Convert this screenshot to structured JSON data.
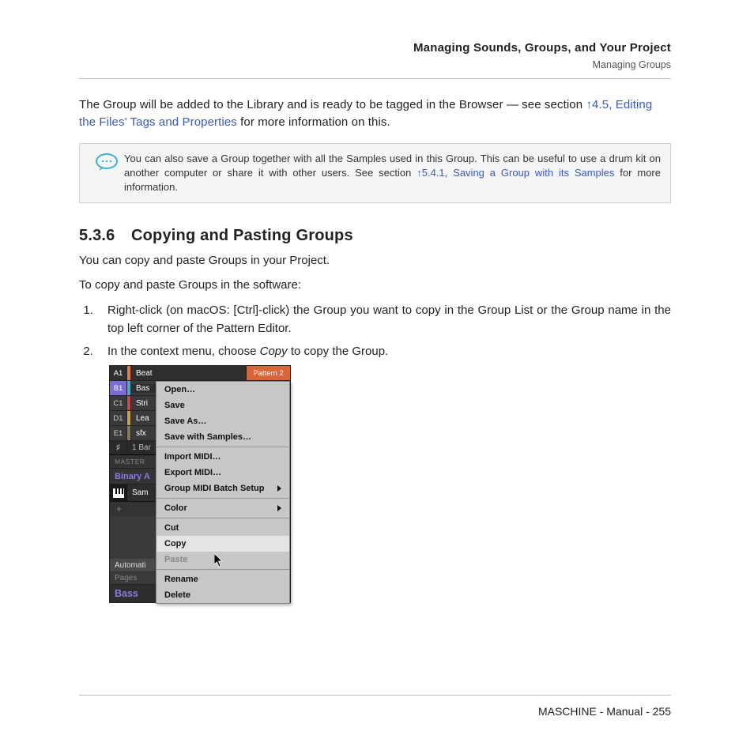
{
  "header": {
    "title": "Managing Sounds, Groups, and Your Project",
    "sub": "Managing Groups"
  },
  "intro": {
    "pre": "The Group will be added to the Library and is ready to be tagged in the Browser — see section ",
    "link": "↑4.5, Editing the Files' Tags and Properties",
    "post": " for more information on this."
  },
  "callout": {
    "pre": "You can also save a Group together with all the Samples used in this Group. This can be useful to use a drum kit on another computer or share it with other users. See section ",
    "link": "↑5.4.1, Saving a Group with its Samples",
    "post": " for more information."
  },
  "section": {
    "num": "5.3.6",
    "title": "Copying and Pasting Groups"
  },
  "p1": "You can copy and paste Groups in your Project.",
  "p2": "To copy and paste Groups in the software:",
  "steps": [
    "Right-click (on macOS: [Ctrl]-click) the Group you want to copy in the Group List or the Group name in the top left corner of the Pattern Editor.",
    {
      "pre": "In the context menu, choose ",
      "em": "Copy",
      "post": " to copy the Group."
    }
  ],
  "shot": {
    "rows": [
      {
        "id": "A1",
        "name": "Beat",
        "cls": "row-a",
        "pattern": "Pattern 2"
      },
      {
        "id": "B1",
        "name": "Bas",
        "cls": "row-b"
      },
      {
        "id": "C1",
        "name": "Stri",
        "cls": "row-c"
      },
      {
        "id": "D1",
        "name": "Lea",
        "cls": "row-d"
      },
      {
        "id": "E1",
        "name": "sfx",
        "cls": "row-e"
      }
    ],
    "bar": "1 Bar",
    "master": "MASTER",
    "binary": "Binary A",
    "sam": "Sam",
    "plus": "+",
    "auto": "Automati",
    "pages": "Pages",
    "bass": "Bass"
  },
  "ctx": {
    "items": [
      {
        "label": "Open…"
      },
      {
        "label": "Save"
      },
      {
        "label": "Save As…"
      },
      {
        "label": "Save with Samples…"
      },
      {
        "sep": true
      },
      {
        "label": "Import MIDI…"
      },
      {
        "label": "Export MIDI…"
      },
      {
        "label": "Group MIDI Batch Setup",
        "arrow": true
      },
      {
        "sep": true
      },
      {
        "label": "Color",
        "arrow": true
      },
      {
        "sep": true
      },
      {
        "label": "Cut"
      },
      {
        "label": "Copy",
        "hl": true
      },
      {
        "label": "Paste",
        "disabled": true
      },
      {
        "sep": true
      },
      {
        "label": "Rename"
      },
      {
        "label": "Delete"
      }
    ]
  },
  "footer": "MASCHINE - Manual - 255"
}
